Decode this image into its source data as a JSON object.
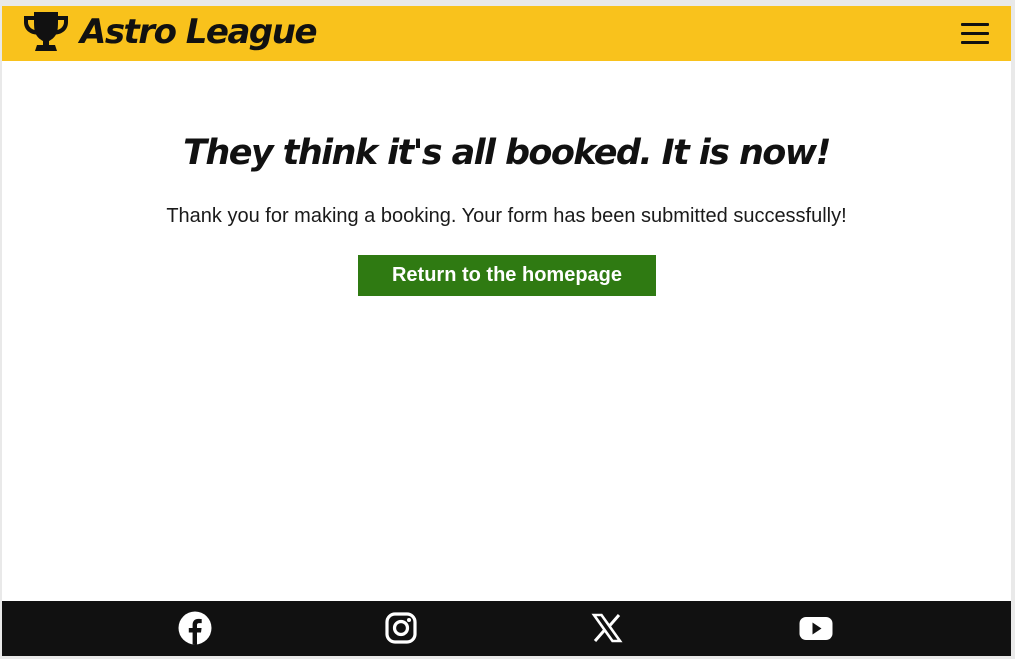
{
  "header": {
    "brand_name": "Astro League",
    "logo_icon": "trophy-icon",
    "menu_icon": "hamburger-menu-icon",
    "background_color": "#f9c21c"
  },
  "main": {
    "headline": "They think it's all booked. It is now!",
    "message": "Thank you for making a booking. Your form has been submitted successfully!",
    "home_button_label": "Return to the homepage",
    "button_color": "#2f7a12"
  },
  "footer": {
    "background_color": "#111111",
    "social_links": [
      {
        "name": "Facebook",
        "icon": "facebook-icon"
      },
      {
        "name": "Instagram",
        "icon": "instagram-icon"
      },
      {
        "name": "X",
        "icon": "x-icon"
      },
      {
        "name": "YouTube",
        "icon": "youtube-icon"
      }
    ]
  }
}
